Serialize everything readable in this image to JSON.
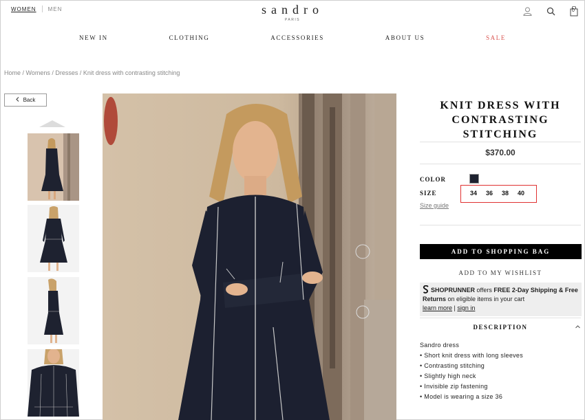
{
  "header": {
    "gender_women": "WOMEN",
    "gender_men": "MEN",
    "brand": "sandro",
    "brand_sub": "PARIS",
    "account_icon": "user-icon",
    "search_icon": "search-icon",
    "bag_icon": "shopping-bag-icon",
    "bag_count": "0"
  },
  "nav": {
    "items": [
      "NEW IN",
      "CLOTHING",
      "ACCESSORIES",
      "ABOUT US",
      "SALE"
    ]
  },
  "breadcrumb": "Home / Womens / Dresses / Knit dress with contrasting stitching",
  "gallery": {
    "back_label": "Back",
    "thumbnails": [
      "front view",
      "back view",
      "side view",
      "close-up"
    ]
  },
  "product": {
    "title": "KNIT DRESS WITH CONTRASTING STITCHING",
    "price": "$370.00",
    "color_label": "COLOR",
    "color_hex": "#1e2230",
    "size_label": "SIZE",
    "sizes": [
      "34",
      "36",
      "38",
      "40"
    ],
    "size_guide": "Size guide",
    "add_to_bag": "ADD TO SHOPPING BAG",
    "wishlist": "ADD TO MY WISHLIST"
  },
  "shoprunner": {
    "brand": "SHOPRUNNER",
    "text1": " offers ",
    "bold1": "FREE 2-Day Shipping & Free Returns",
    "text2": " on eligible items in your cart",
    "learn_more": "learn more",
    "sign_in": "sign in"
  },
  "description": {
    "title": "DESCRIPTION",
    "intro": "Sandro dress",
    "bullets": [
      "Short knit dress with long sleeves",
      "Contrasting stitching",
      "Slightly high neck",
      "Invisible zip fastening",
      "Model is wearing a size 36"
    ]
  },
  "colors": {
    "sale": "#d9534f",
    "highlight_box": "#e03030",
    "button": "#000000"
  }
}
